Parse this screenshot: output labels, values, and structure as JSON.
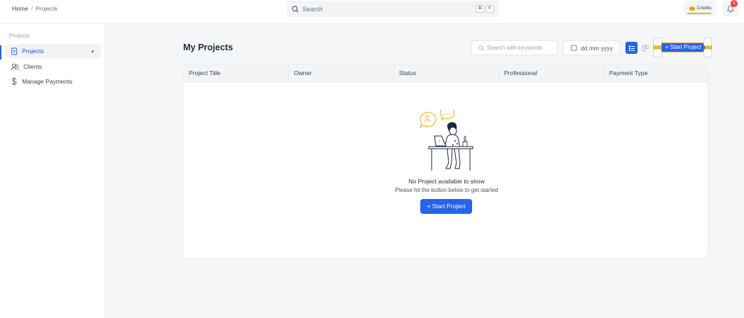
{
  "breadcrumb": {
    "home": "Home",
    "separator": "/",
    "current": "Projects"
  },
  "search": {
    "placeholder": "Search",
    "shortcut_mod": "⌘",
    "shortcut_key": "K"
  },
  "credits": {
    "label": "Credits"
  },
  "notifications": {
    "count": "4"
  },
  "sidebar": {
    "section_label": "Projects",
    "items": [
      {
        "label": "Projects",
        "icon": "document-icon",
        "active": true
      },
      {
        "label": "Clients",
        "icon": "users-icon"
      },
      {
        "label": "Manage Payments",
        "icon": "dollar-icon"
      }
    ]
  },
  "main": {
    "title": "My Projects",
    "keyword_search_placeholder": "Search with keywords",
    "date_placeholder": "dd mm yyyy",
    "start_project_label": "+ Start Project"
  },
  "table": {
    "columns": [
      "Project Title",
      "Owner",
      "Status",
      "Professional",
      "Payment Type"
    ]
  },
  "empty_state": {
    "title": "No Project available to show",
    "subtitle": "Please hit the button below to get started",
    "button_label": "+ Start Project"
  },
  "colors": {
    "accent": "#2563eb",
    "highlight": "#f2b21c",
    "badge": "#ef4444"
  }
}
